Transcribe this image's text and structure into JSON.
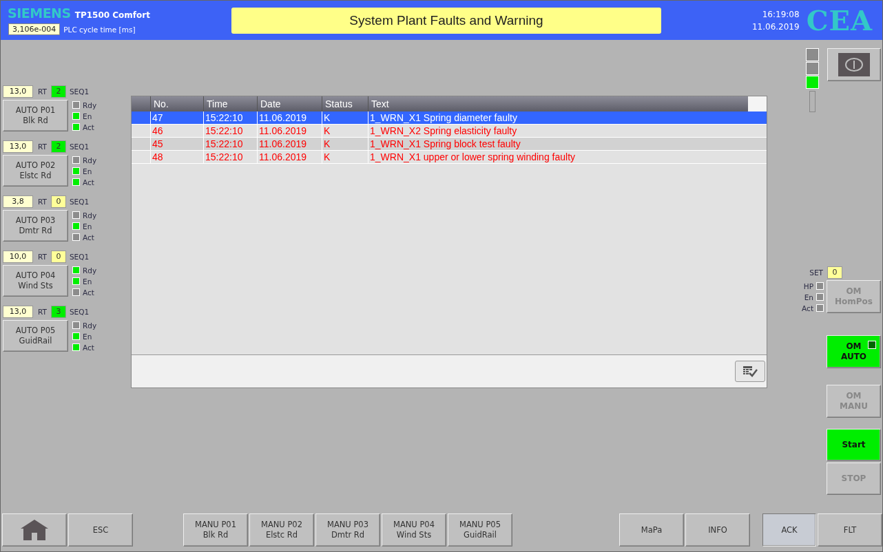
{
  "header": {
    "brand": "SIEMENS",
    "model": "TP1500 Comfort",
    "cycle_value": "3,106e-004",
    "cycle_label": "PLC cycle time [ms]",
    "title": "System Plant Faults and Warning",
    "time": "16:19:08",
    "date": "11.06.2019",
    "logo": "CEA"
  },
  "stations": [
    {
      "rt_value": "13,0",
      "rt_label": "RT",
      "seq_value": "2",
      "seq_running": true,
      "seq_label": "SEQ1",
      "button_lines": [
        "AUTO P01",
        "Blk Rd"
      ],
      "lamps": [
        {
          "label": "Rdy",
          "on": false
        },
        {
          "label": "En",
          "on": true
        },
        {
          "label": "Act",
          "on": true
        }
      ]
    },
    {
      "rt_value": "13,0",
      "rt_label": "RT",
      "seq_value": "2",
      "seq_running": true,
      "seq_label": "SEQ1",
      "button_lines": [
        "AUTO P02",
        "Elstc Rd"
      ],
      "lamps": [
        {
          "label": "Rdy",
          "on": false
        },
        {
          "label": "En",
          "on": true
        },
        {
          "label": "Act",
          "on": true
        }
      ]
    },
    {
      "rt_value": "3,8",
      "rt_label": "RT",
      "seq_value": "0",
      "seq_running": false,
      "seq_label": "SEQ1",
      "button_lines": [
        "AUTO P03",
        "Dmtr Rd"
      ],
      "lamps": [
        {
          "label": "Rdy",
          "on": false
        },
        {
          "label": "En",
          "on": true
        },
        {
          "label": "Act",
          "on": false
        }
      ]
    },
    {
      "rt_value": "10,0",
      "rt_label": "RT",
      "seq_value": "0",
      "seq_running": false,
      "seq_label": "SEQ1",
      "button_lines": [
        "AUTO P04",
        "Wind Sts"
      ],
      "lamps": [
        {
          "label": "Rdy",
          "on": true
        },
        {
          "label": "En",
          "on": true
        },
        {
          "label": "Act",
          "on": false
        }
      ]
    },
    {
      "rt_value": "13,0",
      "rt_label": "RT",
      "seq_value": "3",
      "seq_running": true,
      "seq_label": "SEQ1",
      "button_lines": [
        "AUTO P05",
        "GuidRail"
      ],
      "lamps": [
        {
          "label": "Rdy",
          "on": false
        },
        {
          "label": "En",
          "on": true
        },
        {
          "label": "Act",
          "on": true
        }
      ]
    }
  ],
  "alarm_table": {
    "columns": [
      "No.",
      "Time",
      "Date",
      "Status",
      "Text"
    ],
    "rows": [
      {
        "selected": true,
        "cells": [
          "47",
          "15:22:10",
          "11.06.2019",
          "K",
          "1_WRN_X1 Spring diameter faulty"
        ]
      },
      {
        "selected": false,
        "cells": [
          "46",
          "15:22:10",
          "11.06.2019",
          "K",
          "1_WRN_X2 Spring elasticity faulty"
        ]
      },
      {
        "selected": false,
        "cells": [
          "45",
          "15:22:10",
          "11.06.2019",
          "K",
          "1_WRN_X1 Spring block test faulty"
        ]
      },
      {
        "selected": false,
        "cells": [
          "48",
          "15:22:10",
          "11.06.2019",
          "K",
          "1_WRN_X1 upper or lower spring winding faulty"
        ]
      }
    ]
  },
  "status_lamps": [
    {
      "on": false
    },
    {
      "on": false
    },
    {
      "on": true
    }
  ],
  "homing": {
    "set_label": "SET",
    "set_value": "0",
    "lamps": [
      {
        "label": "HP",
        "on": false
      },
      {
        "label": "En",
        "on": false
      },
      {
        "label": "Act",
        "on": false
      }
    ]
  },
  "mode_buttons": [
    {
      "lines": [
        "OM",
        "HomPos"
      ],
      "enabled": false,
      "active": false
    },
    {
      "lines": [
        "OM",
        "AUTO"
      ],
      "enabled": true,
      "active": true,
      "lamp_on": false
    },
    {
      "lines": [
        "OM",
        "MANU"
      ],
      "enabled": false,
      "active": false
    },
    {
      "lines": [
        "Start"
      ],
      "enabled": true,
      "active": true
    },
    {
      "lines": [
        "STOP"
      ],
      "enabled": false,
      "active": false
    }
  ],
  "footer": {
    "left": [
      {
        "kind": "home"
      },
      {
        "kind": "text",
        "lines": [
          "ESC"
        ],
        "pressed": false
      }
    ],
    "middle": [
      {
        "kind": "text",
        "lines": [
          "MANU P01",
          "Blk Rd"
        ],
        "pressed": false
      },
      {
        "kind": "text",
        "lines": [
          "MANU P02",
          "Elstc Rd"
        ],
        "pressed": false
      },
      {
        "kind": "text",
        "lines": [
          "MANU P03",
          "Dmtr Rd"
        ],
        "pressed": false
      },
      {
        "kind": "text",
        "lines": [
          "MANU P04",
          "Wind Sts"
        ],
        "pressed": false
      },
      {
        "kind": "text",
        "lines": [
          "MANU P05",
          "GuidRail"
        ],
        "pressed": false
      }
    ],
    "right": [
      {
        "kind": "text",
        "lines": [
          "MaPa"
        ],
        "pressed": false
      },
      {
        "kind": "text",
        "lines": [
          "INFO"
        ],
        "pressed": false
      },
      {
        "kind": "text",
        "lines": [
          "ACK"
        ],
        "pressed": true
      },
      {
        "kind": "text",
        "lines": [
          "FLT"
        ],
        "pressed": false
      }
    ]
  }
}
